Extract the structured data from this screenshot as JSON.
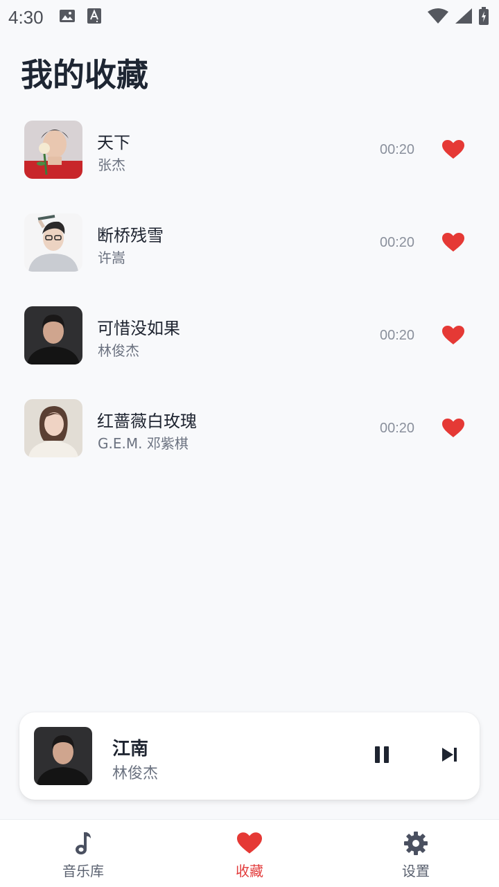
{
  "status_bar": {
    "time": "4:30",
    "icons": [
      "image-icon",
      "text-a-icon",
      "wifi-icon",
      "signal-icon",
      "battery-charging-icon"
    ]
  },
  "page": {
    "title": "我的收藏"
  },
  "songs": [
    {
      "title": "天下",
      "artist": "张杰",
      "duration": "00:20",
      "favorited": true,
      "cover": "cover-zhangjie"
    },
    {
      "title": "断桥残雪",
      "artist": "许嵩",
      "duration": "00:20",
      "favorited": true,
      "cover": "cover-xusong"
    },
    {
      "title": "可惜没如果",
      "artist": "林俊杰",
      "duration": "00:20",
      "favorited": true,
      "cover": "cover-linjunjie"
    },
    {
      "title": "红蔷薇白玫瑰",
      "artist": "G.E.M. 邓紫棋",
      "duration": "00:20",
      "favorited": true,
      "cover": "cover-gem"
    }
  ],
  "now_playing": {
    "title": "江南",
    "artist": "林俊杰",
    "state": "playing"
  },
  "bottom_nav": {
    "items": [
      {
        "label": "音乐库",
        "icon": "music-note-icon",
        "active": false
      },
      {
        "label": "收藏",
        "icon": "heart-icon",
        "active": true
      },
      {
        "label": "设置",
        "icon": "gear-icon",
        "active": false
      }
    ]
  },
  "colors": {
    "accent": "#e23b3b",
    "background": "#f8f9fb",
    "text": "#1e2430",
    "muted": "#6b7280"
  }
}
